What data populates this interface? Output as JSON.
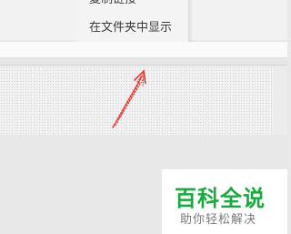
{
  "context_menu": {
    "items": [
      {
        "label": "复制链接"
      },
      {
        "label": "在文件夹中显示"
      }
    ]
  },
  "watermark": {
    "title": "百科全说",
    "subtitle": "助你轻松解决"
  },
  "colors": {
    "arrow": "#e0302a",
    "watermark_green": "#1aa83f",
    "background": "#e9e9e9"
  }
}
